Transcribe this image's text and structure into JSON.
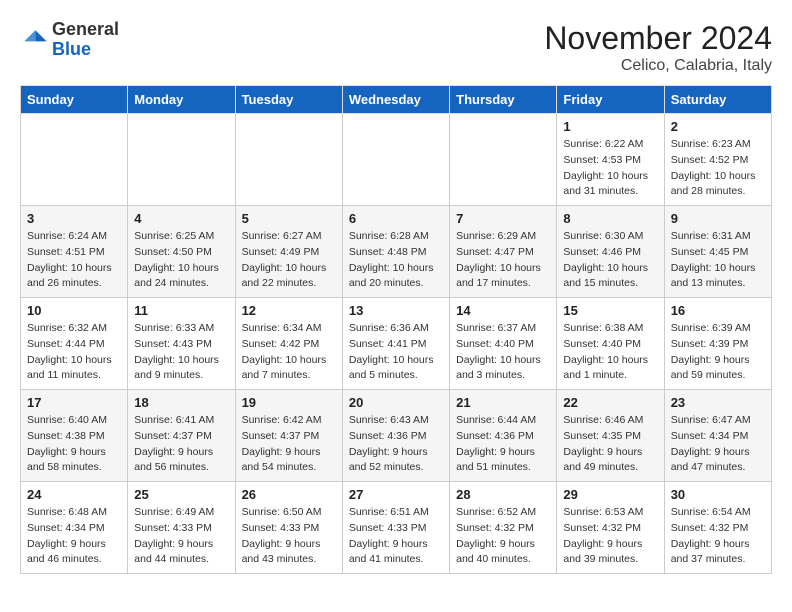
{
  "header": {
    "logo_general": "General",
    "logo_blue": "Blue",
    "month_title": "November 2024",
    "location": "Celico, Calabria, Italy"
  },
  "days_of_week": [
    "Sunday",
    "Monday",
    "Tuesday",
    "Wednesday",
    "Thursday",
    "Friday",
    "Saturday"
  ],
  "weeks": [
    [
      {
        "day": "",
        "info": ""
      },
      {
        "day": "",
        "info": ""
      },
      {
        "day": "",
        "info": ""
      },
      {
        "day": "",
        "info": ""
      },
      {
        "day": "",
        "info": ""
      },
      {
        "day": "1",
        "info": "Sunrise: 6:22 AM\nSunset: 4:53 PM\nDaylight: 10 hours and 31 minutes."
      },
      {
        "day": "2",
        "info": "Sunrise: 6:23 AM\nSunset: 4:52 PM\nDaylight: 10 hours and 28 minutes."
      }
    ],
    [
      {
        "day": "3",
        "info": "Sunrise: 6:24 AM\nSunset: 4:51 PM\nDaylight: 10 hours and 26 minutes."
      },
      {
        "day": "4",
        "info": "Sunrise: 6:25 AM\nSunset: 4:50 PM\nDaylight: 10 hours and 24 minutes."
      },
      {
        "day": "5",
        "info": "Sunrise: 6:27 AM\nSunset: 4:49 PM\nDaylight: 10 hours and 22 minutes."
      },
      {
        "day": "6",
        "info": "Sunrise: 6:28 AM\nSunset: 4:48 PM\nDaylight: 10 hours and 20 minutes."
      },
      {
        "day": "7",
        "info": "Sunrise: 6:29 AM\nSunset: 4:47 PM\nDaylight: 10 hours and 17 minutes."
      },
      {
        "day": "8",
        "info": "Sunrise: 6:30 AM\nSunset: 4:46 PM\nDaylight: 10 hours and 15 minutes."
      },
      {
        "day": "9",
        "info": "Sunrise: 6:31 AM\nSunset: 4:45 PM\nDaylight: 10 hours and 13 minutes."
      }
    ],
    [
      {
        "day": "10",
        "info": "Sunrise: 6:32 AM\nSunset: 4:44 PM\nDaylight: 10 hours and 11 minutes."
      },
      {
        "day": "11",
        "info": "Sunrise: 6:33 AM\nSunset: 4:43 PM\nDaylight: 10 hours and 9 minutes."
      },
      {
        "day": "12",
        "info": "Sunrise: 6:34 AM\nSunset: 4:42 PM\nDaylight: 10 hours and 7 minutes."
      },
      {
        "day": "13",
        "info": "Sunrise: 6:36 AM\nSunset: 4:41 PM\nDaylight: 10 hours and 5 minutes."
      },
      {
        "day": "14",
        "info": "Sunrise: 6:37 AM\nSunset: 4:40 PM\nDaylight: 10 hours and 3 minutes."
      },
      {
        "day": "15",
        "info": "Sunrise: 6:38 AM\nSunset: 4:40 PM\nDaylight: 10 hours and 1 minute."
      },
      {
        "day": "16",
        "info": "Sunrise: 6:39 AM\nSunset: 4:39 PM\nDaylight: 9 hours and 59 minutes."
      }
    ],
    [
      {
        "day": "17",
        "info": "Sunrise: 6:40 AM\nSunset: 4:38 PM\nDaylight: 9 hours and 58 minutes."
      },
      {
        "day": "18",
        "info": "Sunrise: 6:41 AM\nSunset: 4:37 PM\nDaylight: 9 hours and 56 minutes."
      },
      {
        "day": "19",
        "info": "Sunrise: 6:42 AM\nSunset: 4:37 PM\nDaylight: 9 hours and 54 minutes."
      },
      {
        "day": "20",
        "info": "Sunrise: 6:43 AM\nSunset: 4:36 PM\nDaylight: 9 hours and 52 minutes."
      },
      {
        "day": "21",
        "info": "Sunrise: 6:44 AM\nSunset: 4:36 PM\nDaylight: 9 hours and 51 minutes."
      },
      {
        "day": "22",
        "info": "Sunrise: 6:46 AM\nSunset: 4:35 PM\nDaylight: 9 hours and 49 minutes."
      },
      {
        "day": "23",
        "info": "Sunrise: 6:47 AM\nSunset: 4:34 PM\nDaylight: 9 hours and 47 minutes."
      }
    ],
    [
      {
        "day": "24",
        "info": "Sunrise: 6:48 AM\nSunset: 4:34 PM\nDaylight: 9 hours and 46 minutes."
      },
      {
        "day": "25",
        "info": "Sunrise: 6:49 AM\nSunset: 4:33 PM\nDaylight: 9 hours and 44 minutes."
      },
      {
        "day": "26",
        "info": "Sunrise: 6:50 AM\nSunset: 4:33 PM\nDaylight: 9 hours and 43 minutes."
      },
      {
        "day": "27",
        "info": "Sunrise: 6:51 AM\nSunset: 4:33 PM\nDaylight: 9 hours and 41 minutes."
      },
      {
        "day": "28",
        "info": "Sunrise: 6:52 AM\nSunset: 4:32 PM\nDaylight: 9 hours and 40 minutes."
      },
      {
        "day": "29",
        "info": "Sunrise: 6:53 AM\nSunset: 4:32 PM\nDaylight: 9 hours and 39 minutes."
      },
      {
        "day": "30",
        "info": "Sunrise: 6:54 AM\nSunset: 4:32 PM\nDaylight: 9 hours and 37 minutes."
      }
    ]
  ]
}
